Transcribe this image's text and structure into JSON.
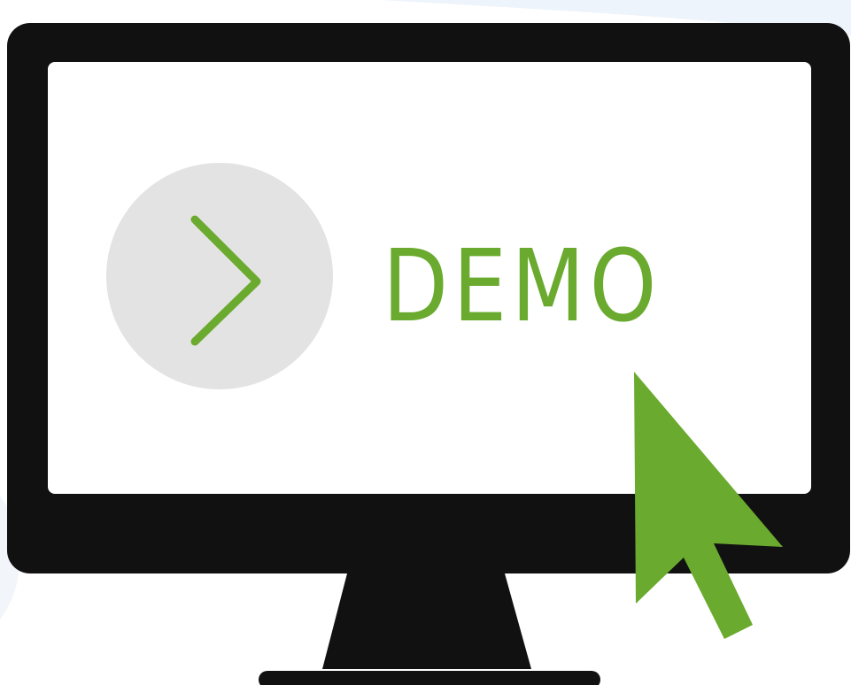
{
  "demo": {
    "label": "DEMO"
  },
  "icons": {
    "play": "chevron-right-icon",
    "cursor": "mouse-pointer-icon",
    "monitor": "monitor-icon"
  },
  "colors": {
    "accent": "#6aaa2e",
    "cursor": "#6aaa2e",
    "frame": "#111111",
    "screen": "#ffffff",
    "circle": "#e3e3e3",
    "swoosh": "#eef4fb"
  }
}
